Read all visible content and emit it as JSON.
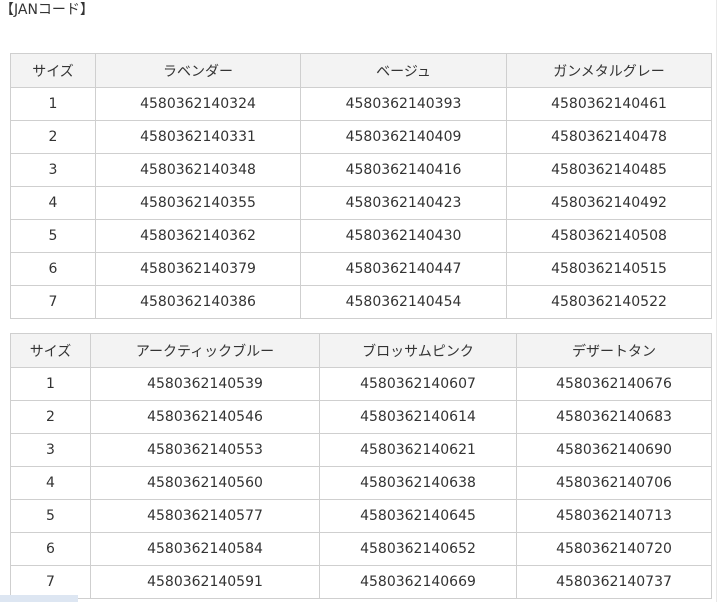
{
  "heading": "【JANコード】",
  "table1": {
    "headers": [
      "サイズ",
      "ラベンダー",
      "ベージュ",
      "ガンメタルグレー"
    ],
    "rows": [
      [
        "1",
        "4580362140324",
        "4580362140393",
        "4580362140461"
      ],
      [
        "2",
        "4580362140331",
        "4580362140409",
        "4580362140478"
      ],
      [
        "3",
        "4580362140348",
        "4580362140416",
        "4580362140485"
      ],
      [
        "4",
        "4580362140355",
        "4580362140423",
        "4580362140492"
      ],
      [
        "5",
        "4580362140362",
        "4580362140430",
        "4580362140508"
      ],
      [
        "6",
        "4580362140379",
        "4580362140447",
        "4580362140515"
      ],
      [
        "7",
        "4580362140386",
        "4580362140454",
        "4580362140522"
      ]
    ]
  },
  "table2": {
    "headers": [
      "サイズ",
      "アークティックブルー",
      "ブロッサムピンク",
      "デザートタン"
    ],
    "rows": [
      [
        "1",
        "4580362140539",
        "4580362140607",
        "4580362140676"
      ],
      [
        "2",
        "4580362140546",
        "4580362140614",
        "4580362140683"
      ],
      [
        "3",
        "4580362140553",
        "4580362140621",
        "4580362140690"
      ],
      [
        "4",
        "4580362140560",
        "4580362140638",
        "4580362140706"
      ],
      [
        "5",
        "4580362140577",
        "4580362140645",
        "4580362140713"
      ],
      [
        "6",
        "4580362140584",
        "4580362140652",
        "4580362140720"
      ],
      [
        "7",
        "4580362140591",
        "4580362140669",
        "4580362140737"
      ]
    ]
  },
  "colors": {
    "header_background": "#f3f3f3",
    "border": "#cfcfcf",
    "text": "#333333"
  }
}
